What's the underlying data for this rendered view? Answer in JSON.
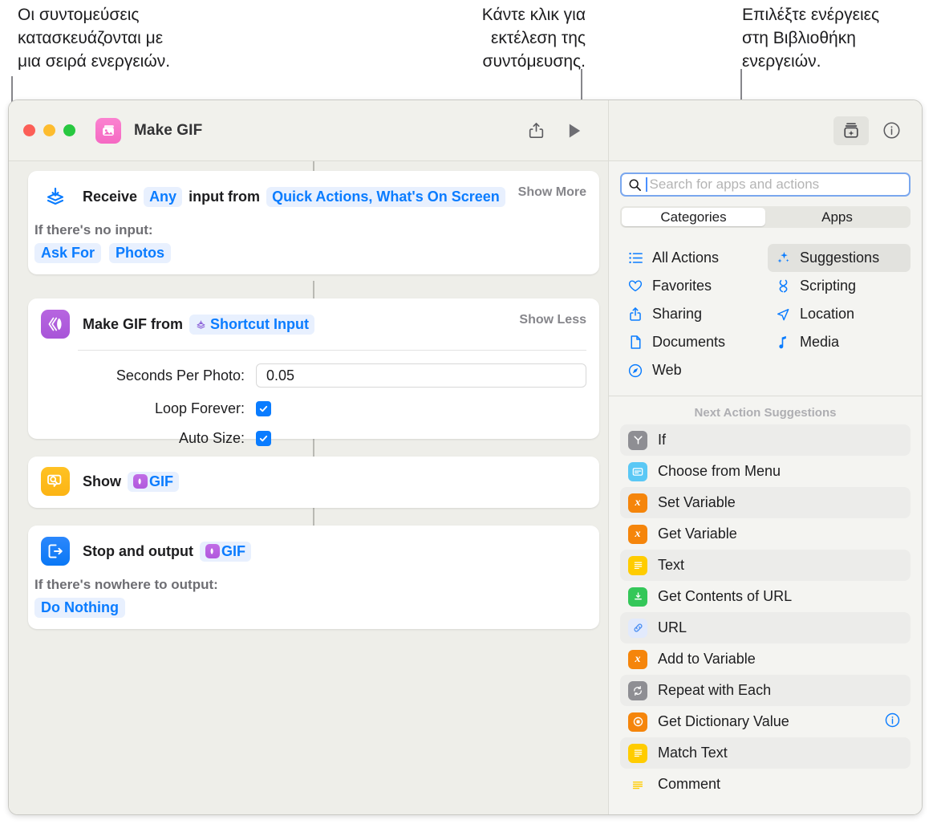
{
  "callouts": {
    "left": "Οι συντομεύσεις\nκατασκευάζονται με\nμια σειρά ενεργειών.",
    "middle": "Κάντε κλικ για\nεκτέλεση της\nσυντόμευσης.",
    "right": "Επιλέξτε ενέργειες\nστη Βιβλιοθήκη\nενεργειών."
  },
  "window": {
    "title": "Make GIF",
    "app_icon_name": "photos-stack-icon",
    "traffic_lights": [
      "close",
      "minimize",
      "zoom"
    ],
    "toolbar": {
      "share_label": "share-icon",
      "run_label": "play-icon",
      "library_label": "action-library-icon",
      "info_label": "info-icon"
    }
  },
  "editor": {
    "actions": [
      {
        "icon": "receive-input-icon",
        "title": "Receive",
        "token1": "Any",
        "mid_text": "input from",
        "token2": "Quick Actions, What's On Screen",
        "toggle": "Show More",
        "sub_label": "If there's no input:",
        "chips": [
          "Ask For",
          "Photos"
        ]
      },
      {
        "icon": "make-gif-icon",
        "title": "Make GIF from",
        "token1": "Shortcut Input",
        "toggle": "Show Less",
        "params": [
          {
            "label": "Seconds Per Photo:",
            "type": "text",
            "value": "0.05"
          },
          {
            "label": "Loop Forever:",
            "type": "checkbox",
            "value": "checked"
          },
          {
            "label": "Auto Size:",
            "type": "checkbox",
            "value": "checked"
          }
        ]
      },
      {
        "icon": "show-result-icon",
        "title": "Show",
        "token1": "GIF"
      },
      {
        "icon": "stop-output-icon",
        "title": "Stop and output",
        "token1": "GIF",
        "sub_label": "If there's nowhere to output:",
        "chips": [
          "Do Nothing"
        ]
      }
    ]
  },
  "sidebar": {
    "search": {
      "placeholder": "Search for apps and actions",
      "value": "",
      "icon": "search-icon"
    },
    "segmented": {
      "options": [
        "Categories",
        "Apps"
      ],
      "selected": "Categories"
    },
    "categories": [
      {
        "label": "All Actions",
        "icon": "list-icon",
        "selected": false
      },
      {
        "label": "Suggestions",
        "icon": "sparkles-icon",
        "selected": true
      },
      {
        "label": "Favorites",
        "icon": "heart-icon",
        "selected": false
      },
      {
        "label": "Scripting",
        "icon": "scripting-icon",
        "selected": false
      },
      {
        "label": "Sharing",
        "icon": "share-icon",
        "selected": false
      },
      {
        "label": "Location",
        "icon": "location-icon",
        "selected": false
      },
      {
        "label": "Documents",
        "icon": "document-icon",
        "selected": false
      },
      {
        "label": "Media",
        "icon": "music-note-icon",
        "selected": false
      },
      {
        "label": "Web",
        "icon": "compass-icon",
        "selected": false
      }
    ],
    "suggestions_header": "Next Action Suggestions",
    "suggestions": [
      {
        "label": "If",
        "icon": "if-icon",
        "color": "#8e8e93",
        "glyph": "Y",
        "info": false
      },
      {
        "label": "Choose from Menu",
        "icon": "menu-icon",
        "color": "#5ac8f5",
        "glyph": "▤",
        "info": false
      },
      {
        "label": "Set Variable",
        "icon": "variable-icon",
        "color": "#f5850b",
        "glyph": "x",
        "info": false
      },
      {
        "label": "Get Variable",
        "icon": "variable-icon",
        "color": "#f5850b",
        "glyph": "x",
        "info": false
      },
      {
        "label": "Text",
        "icon": "text-icon",
        "color": "#ffcc00",
        "glyph": "≡",
        "info": false
      },
      {
        "label": "Get Contents of URL",
        "icon": "download-url-icon",
        "color": "#34c759",
        "glyph": "⤓",
        "info": false
      },
      {
        "label": "URL",
        "icon": "link-icon",
        "color": "#e8eefc",
        "glyph": "🔗",
        "info": false
      },
      {
        "label": "Add to Variable",
        "icon": "variable-icon",
        "color": "#f5850b",
        "glyph": "x",
        "info": false
      },
      {
        "label": "Repeat with Each",
        "icon": "repeat-icon",
        "color": "#8e8e93",
        "glyph": "↻",
        "info": false
      },
      {
        "label": "Get Dictionary Value",
        "icon": "dictionary-icon",
        "color": "#f5850b",
        "glyph": "◙",
        "info": true
      },
      {
        "label": "Match Text",
        "icon": "text-icon",
        "color": "#ffcc00",
        "glyph": "≡",
        "info": false
      },
      {
        "label": "Comment",
        "icon": "comment-icon",
        "color": "#ffcc00",
        "glyph": "≡",
        "info": false
      }
    ]
  },
  "colors": {
    "accent_blue": "#0a7cff",
    "token_bg": "#e8f0fe",
    "toolbar_bg": "#f1f1ec",
    "editor_bg": "#eeeee9",
    "sidebar_bg": "#f4f4f1"
  }
}
